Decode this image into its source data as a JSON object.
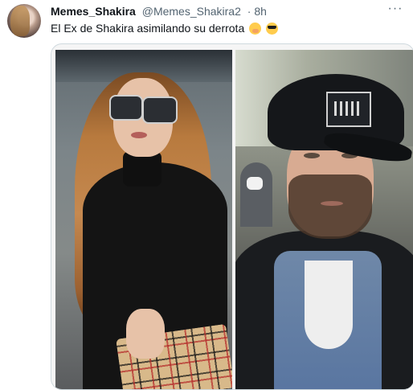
{
  "tweet": {
    "author_name": "Memes_Shakira",
    "author_handle": "@Memes_Shakira2",
    "time": "· 8h",
    "text": "El Ex de Shakira asimilando su derrota",
    "emojis": [
      "shushing-face",
      "smiling-face-with-sunglasses"
    ],
    "more_label": "···"
  },
  "media": {
    "photos": [
      {
        "name": "woman-in-sunglasses-photo"
      },
      {
        "name": "man-in-cap-photo"
      }
    ]
  }
}
